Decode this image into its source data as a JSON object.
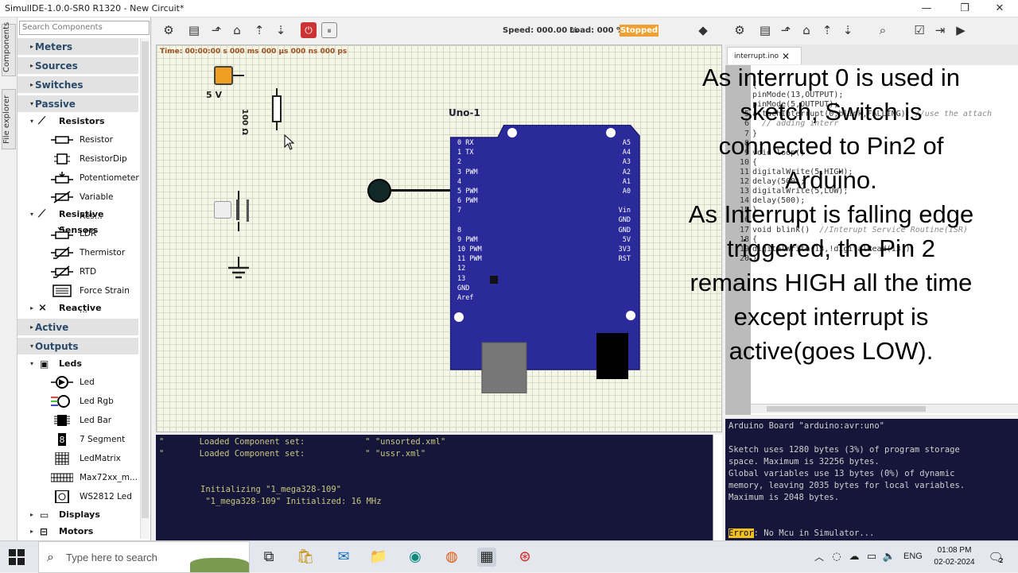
{
  "window": {
    "title": "SimulIDE-1.0.0-SR0 R1320 - New Circuit*",
    "minimize": "—",
    "maximize": "❐",
    "close": "✕"
  },
  "vtabs": [
    "Components",
    "File explorer"
  ],
  "components": {
    "search_placeholder": "Search Components",
    "categories": [
      "Meters",
      "Sources",
      "Switches",
      "Passive",
      "Active",
      "Outputs"
    ],
    "subcats": [
      "Resistors",
      "Resistive Sensors",
      "Reactive",
      "Leds",
      "Displays",
      "Motors"
    ],
    "items": [
      "Resistor",
      "ResistorDip",
      "Potentiometer",
      "Variable Res...",
      "LDR",
      "Thermistor",
      "RTD",
      "Force Strain ...",
      "Led",
      "Led Rgb",
      "Led Bar",
      "7 Segment",
      "LedMatrix",
      "Max72xx_m...",
      "WS2812 Led"
    ]
  },
  "toolbar": {
    "speed": "Speed: 000.00 %",
    "load": "Load: 000 %",
    "status": "Stopped"
  },
  "canvas": {
    "time": "Time: 00:00:00 s  000 ms  000 µs  000 ns  000 ps",
    "source_label": "5 V",
    "resistor_label": "100 Ω",
    "board_label": "Uno-1",
    "left_pins": [
      "0  RX",
      "1  TX",
      "2",
      "3  PWM",
      "4",
      "5  PWM",
      "6  PWM",
      "7",
      "8",
      "9  PWM",
      "10 PWM",
      "11 PWM",
      "12",
      "13",
      "GND",
      "Aref"
    ],
    "right_pins": [
      "A5",
      "A4",
      "A3",
      "A2",
      "A1",
      "A0",
      "Vin",
      "GND",
      "GND",
      "5V",
      "3V3",
      "RST"
    ]
  },
  "editor": {
    "tab": "interrupt.ino",
    "tab_close": "✕",
    "lines": [
      {
        "n": "",
        "code": "{"
      },
      {
        "n": "",
        "code": "pinMode(13,OUTPUT);"
      },
      {
        "n": "",
        "code": "pinMode(5,OUTPUT);"
      },
      {
        "n": "5",
        "code": "attachInterrupt(0,blink,FALLING); ",
        "comment": "//use the attach"
      },
      {
        "n": "6",
        "code": "",
        "comment": "  // adding interr"
      },
      {
        "n": "7",
        "code": "}"
      },
      {
        "n": "8",
        "code": ""
      },
      {
        "n": "9",
        "code": "void loop()"
      },
      {
        "n": "10",
        "code": "{"
      },
      {
        "n": "11",
        "code": "digitalWrite(5,HIGH);"
      },
      {
        "n": "12",
        "code": "delay(500);"
      },
      {
        "n": "13",
        "code": "digitalWrite(5,LOW);"
      },
      {
        "n": "14",
        "code": "delay(500);"
      },
      {
        "n": "15",
        "code": "}"
      },
      {
        "n": "16",
        "code": ""
      },
      {
        "n": "17",
        "code": "void blink()  ",
        "comment": "//Interupt Service Routine(ISR)"
      },
      {
        "n": "18",
        "code": "{"
      },
      {
        "n": "19",
        "code": "digitalWrite(13,!digitalRead(13));"
      },
      {
        "n": "20",
        "code": "}"
      }
    ]
  },
  "overlay": [
    "As interrupt 0 is used in",
    "sketch, Switch is",
    "connected to Pin2 of",
    "Arduino.",
    "As Interrupt is falling edge",
    "triggered, the Pin 2",
    "remains HIGH all the time",
    "except interrupt is",
    "active(goes LOW)."
  ],
  "console": {
    "lines": [
      "\"       Loaded Component set:            \" \"unsorted.xml\"",
      "\"       Loaded Component set:            \" \"ussr.xml\"",
      "Initializing \"1_mega328-109\"",
      " \"1_mega328-109\" Initialized: 16 MHz"
    ]
  },
  "compile": {
    "board": "Arduino Board \"arduino:avr:uno\"",
    "l1": "Sketch uses 1280 bytes (3%) of program storage",
    "l2": "space. Maximum is 32256 bytes.",
    "l3": "Global variables use 13 bytes (0%) of dynamic",
    "l4": "memory, leaving 2035 bytes for local variables.",
    "l5": "Maximum is 2048 bytes.",
    "error_tag": "Error",
    "error_msg": ": No Mcu in Simulator..."
  },
  "taskbar": {
    "search_placeholder": "Type here to search",
    "lang": "ENG",
    "time": "01:08 PM",
    "date": "02-02-2024",
    "notif": "2"
  }
}
